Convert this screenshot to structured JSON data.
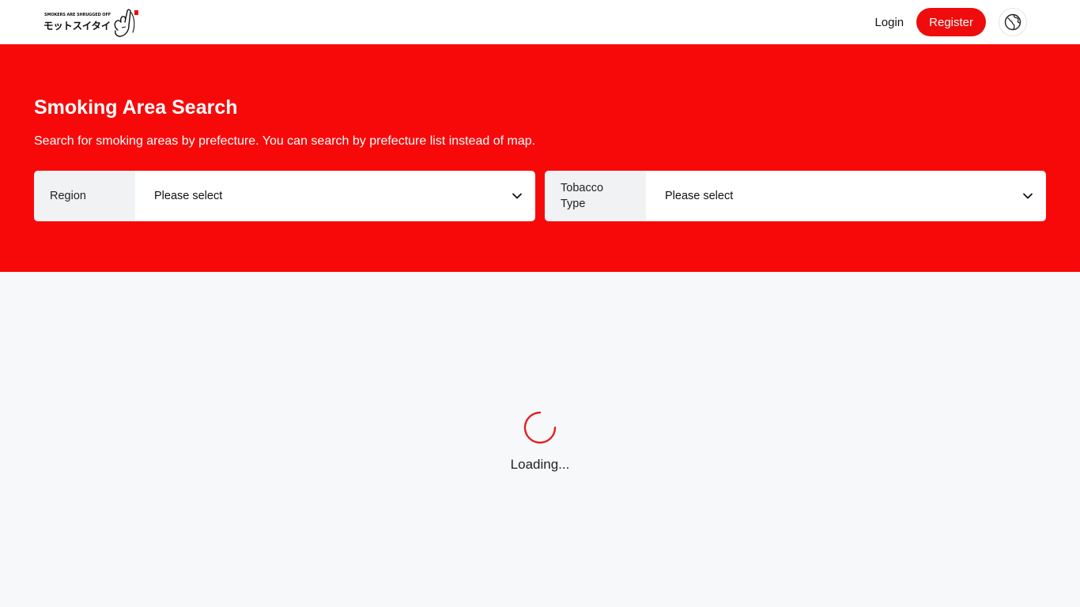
{
  "header": {
    "logo": {
      "tagline": "SMOKERS ARE SHRUGGED OFF",
      "name": "モットスイタイ",
      "icon": "hand-cigarette-icon"
    },
    "login_label": "Login",
    "register_label": "Register",
    "language_icon": "globe-icon"
  },
  "hero": {
    "title": "Smoking Area Search",
    "description": "Search for smoking areas by prefecture. You can search by prefecture list instead of map.",
    "filters": [
      {
        "label": "Region",
        "selected": "Please select",
        "icon": "chevron-down-icon"
      },
      {
        "label": "Tobacco Type",
        "selected": "Please select",
        "icon": "chevron-down-icon"
      }
    ]
  },
  "main": {
    "loading_text": "Loading...",
    "spinner_icon": "loading-spinner-icon"
  },
  "colors": {
    "brand_red": "#f80909",
    "button_red": "#ee0c0c",
    "page_background": "#f7f8fa",
    "label_background": "#f1f2f4"
  }
}
